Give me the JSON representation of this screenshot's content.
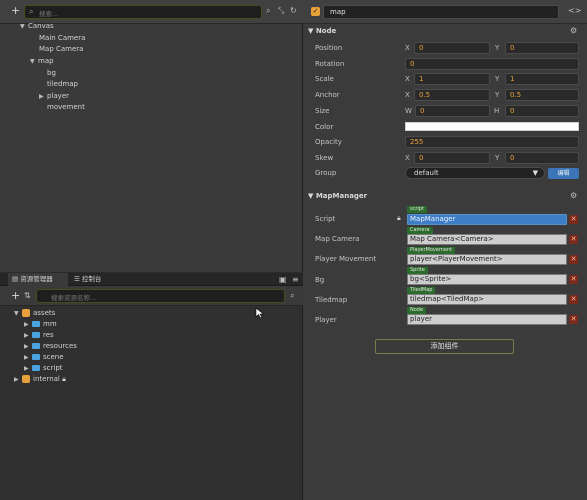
{
  "hierarchy": {
    "search_placeholder": "搜索...",
    "nodes": [
      {
        "label": "Canvas",
        "arrow": "▼"
      },
      {
        "label": "Main Camera",
        "arrow": ""
      },
      {
        "label": "Map Camera",
        "arrow": ""
      },
      {
        "label": "map",
        "arrow": "▼"
      },
      {
        "label": "bg",
        "arrow": ""
      },
      {
        "label": "tiledmap",
        "arrow": ""
      },
      {
        "label": "player",
        "arrow": "▶"
      },
      {
        "label": "movement",
        "arrow": ""
      }
    ]
  },
  "assets": {
    "tabs": [
      "资源管理器",
      "控制台"
    ],
    "search_placeholder": "搜索资源名称...",
    "root_label": "assets",
    "folders": [
      "mm",
      "res",
      "resources",
      "scene",
      "script"
    ],
    "internal_label": "internal"
  },
  "inspector": {
    "node_name": "map",
    "node_section": "Node",
    "position": {
      "label": "Position",
      "x": "0",
      "y": "0"
    },
    "rotation": {
      "label": "Rotation",
      "value": "0"
    },
    "scale": {
      "label": "Scale",
      "x": "1",
      "y": "1"
    },
    "anchor": {
      "label": "Anchor",
      "x": "0.5",
      "y": "0.5"
    },
    "size": {
      "label": "Size",
      "w": "0",
      "h": "0"
    },
    "color": {
      "label": "Color",
      "value": "#ffffff"
    },
    "opacity": {
      "label": "Opacity",
      "value": "255"
    },
    "skew": {
      "label": "Skew",
      "x": "0",
      "y": "0"
    },
    "group": {
      "label": "Group",
      "value": "default",
      "edit_label": "编辑"
    },
    "axis": {
      "x": "X",
      "y": "Y",
      "w": "W",
      "h": "H"
    },
    "component_section": "MapManager",
    "props": [
      {
        "label": "Script",
        "tag": "script",
        "value": "MapManager"
      },
      {
        "label": "Map Camera",
        "tag": "Camera",
        "value": "Map Camera<Camera>"
      },
      {
        "label": "Player Movement",
        "tag": "PlayerMovement",
        "value": "player<PlayerMovement>"
      },
      {
        "label": "Bg",
        "tag": "Sprite",
        "value": "bg<Sprite>"
      },
      {
        "label": "Tiledmap",
        "tag": "TiledMap",
        "value": "tiledmap<TiledMap>"
      },
      {
        "label": "Player",
        "tag": "Node",
        "value": "player"
      }
    ],
    "add_component_label": "添加组件"
  }
}
